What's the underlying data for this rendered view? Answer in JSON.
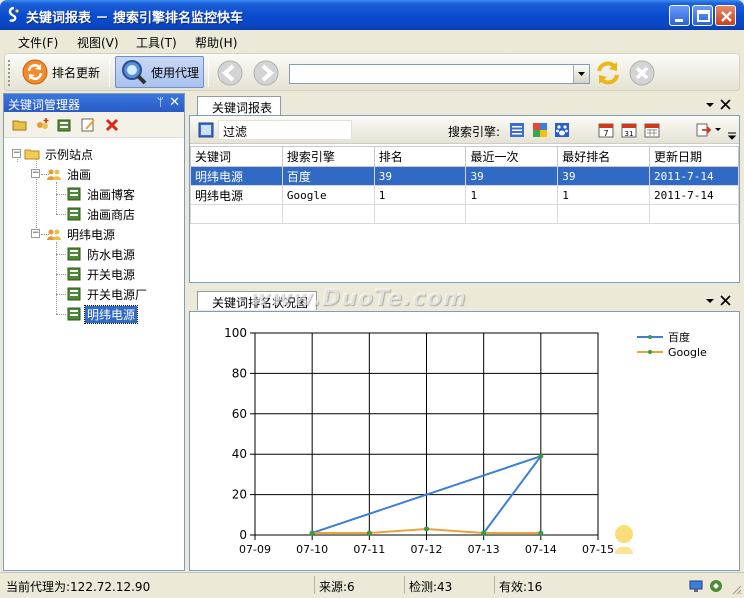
{
  "window": {
    "title": "关键词报表 － 搜索引擎排名监控快车"
  },
  "menu": [
    "文件(F)",
    "视图(V)",
    "工具(T)",
    "帮助(H)"
  ],
  "toolbar": {
    "rank_update_label": "排名更新",
    "use_proxy_label": "使用代理",
    "url_value": ""
  },
  "left_panel": {
    "title": "关键词管理器",
    "pin_glyph": "ᛘ",
    "close_glyph": "✕",
    "tree": {
      "root": "示例站点",
      "groups": [
        {
          "label": "油画",
          "children": [
            "油画博客",
            "油画商店"
          ]
        },
        {
          "label": "明纬电源",
          "children": [
            "防水电源",
            "开关电源",
            "开关电源厂",
            "明纬电源"
          ]
        }
      ]
    }
  },
  "report": {
    "tab_label": "关键词报表",
    "filter_label": "过滤",
    "search_engine_label": "搜索引擎:",
    "columns": [
      "关键词",
      "搜索引擎",
      "排名",
      "最近一次",
      "最好排名",
      "更新日期"
    ],
    "rows": [
      [
        "明纬电源",
        "百度",
        "39",
        "39",
        "39",
        "2011-7-14"
      ],
      [
        "明纬电源",
        "Google",
        "1",
        "1",
        "1",
        "2011-7-14"
      ]
    ]
  },
  "chart_panel": {
    "tab_label": "关键词排名状况图"
  },
  "chart_data": {
    "type": "line",
    "x": [
      "07-09",
      "07-10",
      "07-11",
      "07-12",
      "07-13",
      "07-14",
      "07-15"
    ],
    "ylim": [
      0,
      100
    ],
    "yticks": [
      0,
      20,
      40,
      60,
      80,
      100
    ],
    "grid": true,
    "legend_position": "top-right",
    "series": [
      {
        "name": "百度",
        "color": "#3b7fd8",
        "points": [
          [
            "07-10",
            1
          ],
          [
            "07-14",
            39
          ],
          [
            "07-13",
            1
          ]
        ]
      },
      {
        "name": "Google",
        "color": "#e8a33c",
        "points": [
          [
            "07-10",
            1
          ],
          [
            "07-11",
            1
          ],
          [
            "07-12",
            3
          ],
          [
            "07-13",
            1
          ],
          [
            "07-14",
            1
          ]
        ]
      }
    ],
    "markers_green": true
  },
  "status": {
    "proxy": "当前代理为:122.72.12.90",
    "source": "来源:6",
    "checked": "检测:43",
    "valid": "有效:16"
  },
  "watermark": "www.DuoTe.com"
}
